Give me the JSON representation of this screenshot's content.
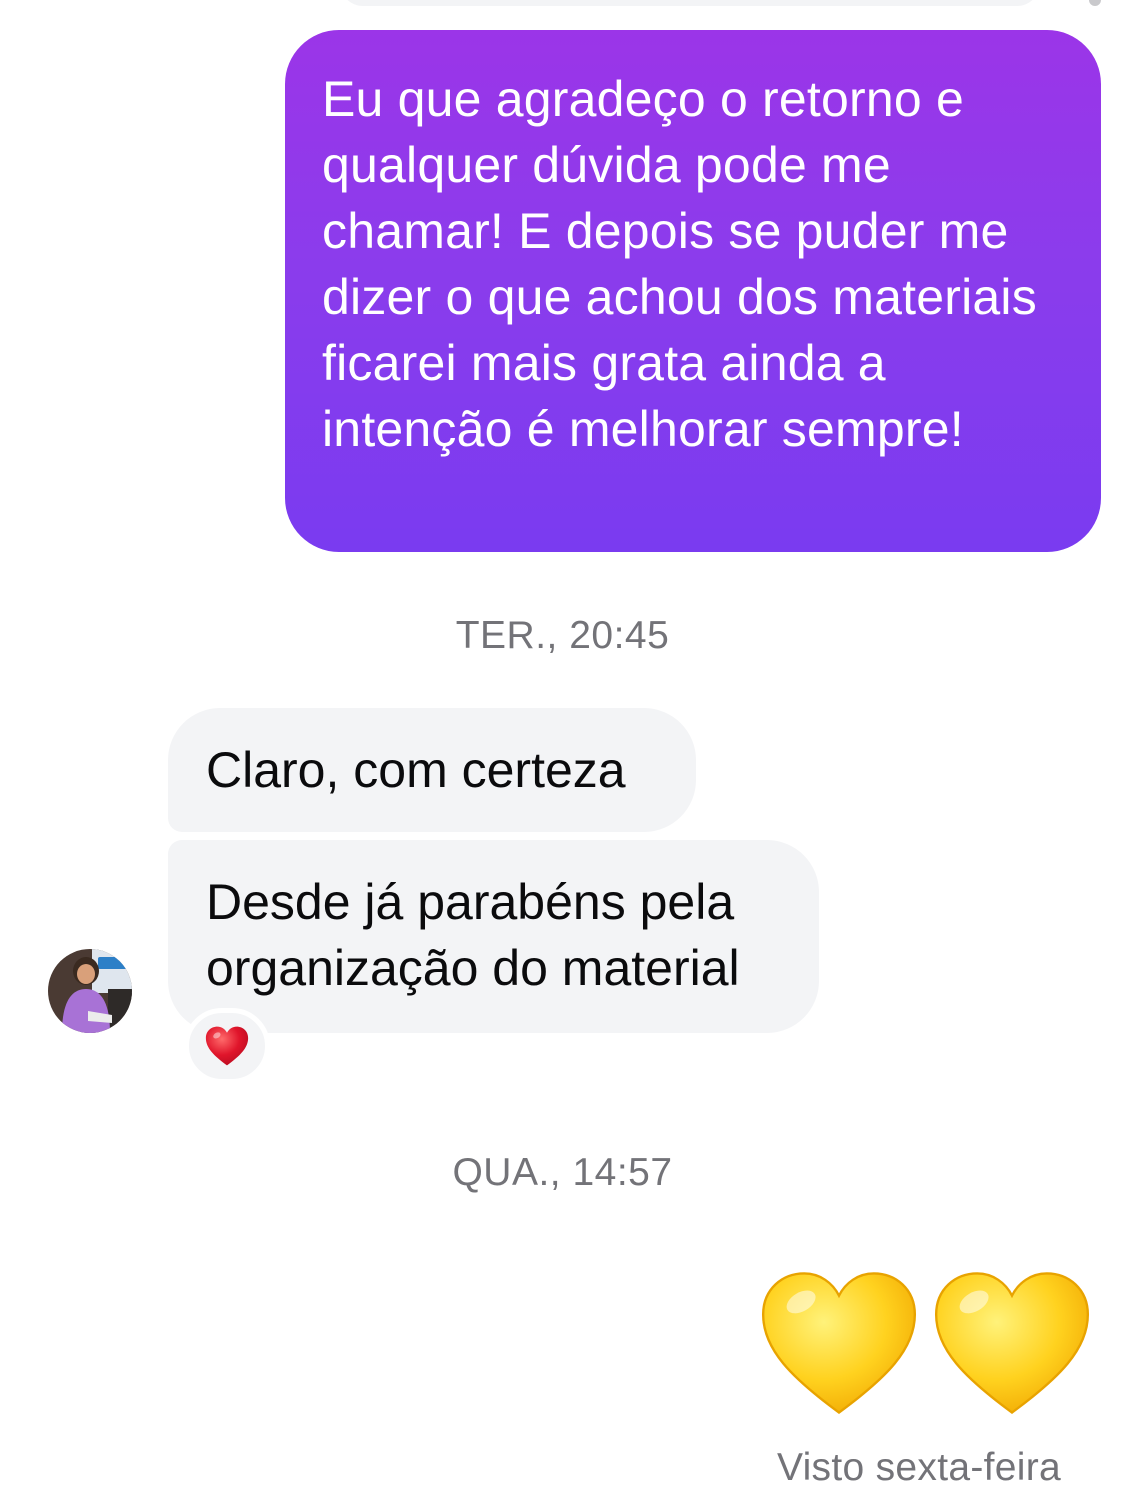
{
  "conversation": {
    "sent_message": "Eu que agradeço o retorno e qualquer dúvida pode me chamar! E depois se puder me dizer o que achou dos materiais ficarei mais grata ainda a intenção é melhorar sempre!",
    "timestamp_1": "TER., 20:45",
    "received_1": "Claro, com certeza",
    "received_2": "Desde já parabéns pela organização do material",
    "received_2_reaction": "❤️",
    "timestamp_2": "QUA., 14:57",
    "sent_emojis": [
      "💛",
      "💛"
    ],
    "seen_status": "Visto sexta-feira"
  },
  "colors": {
    "sent_bubble_top": "#9b35e8",
    "sent_bubble_bottom": "#7a3bf0",
    "received_bubble": "#f3f4f6",
    "meta_text": "#737378",
    "reaction_heart": "#e0152b",
    "yellow_heart": "#ffcc00"
  },
  "icons": {
    "reaction": "red-heart-icon",
    "emoji": "yellow-heart-icon"
  }
}
